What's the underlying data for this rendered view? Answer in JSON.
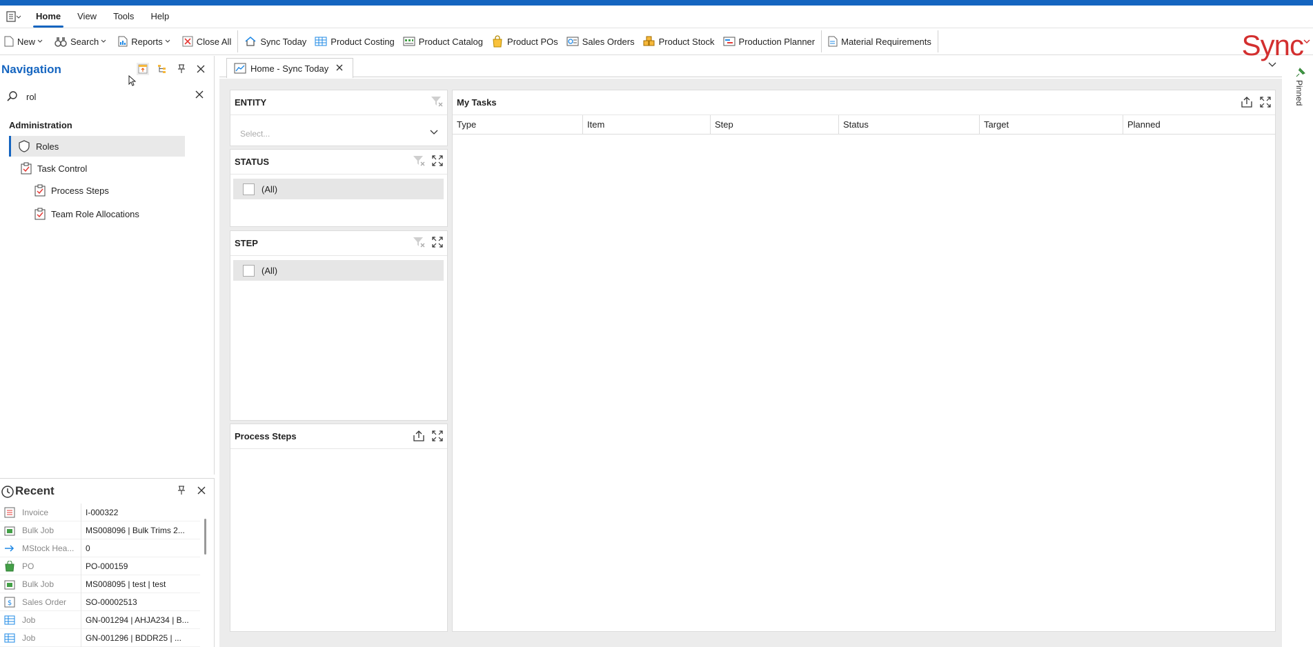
{
  "menubar": {
    "tabs": [
      "Home",
      "View",
      "Tools",
      "Help"
    ],
    "active_tab": "Home"
  },
  "toolbar": {
    "new_label": "New",
    "search_label": "Search",
    "reports_label": "Reports",
    "close_all_label": "Close All",
    "sync_today_label": "Sync Today",
    "product_costing_label": "Product Costing",
    "product_catalog_label": "Product Catalog",
    "product_pos_label": "Product POs",
    "sales_orders_label": "Sales Orders",
    "product_stock_label": "Product Stock",
    "production_planner_label": "Production Planner",
    "material_requirements_label": "Material Requirements",
    "brand": "Sync"
  },
  "navigation": {
    "title": "Navigation",
    "search_value": "rol",
    "group": "Administration",
    "items": [
      {
        "label": "Roles"
      },
      {
        "label": "Task Control"
      },
      {
        "label": "Process Steps"
      },
      {
        "label": "Team Role Allocations"
      }
    ]
  },
  "recent": {
    "title": "Recent",
    "rows": [
      {
        "type": "Invoice",
        "value": "I-000322"
      },
      {
        "type": "Bulk Job",
        "value": "MS008096 | Bulk Trims 2..."
      },
      {
        "type": "MStock Hea...",
        "value": "0"
      },
      {
        "type": "PO",
        "value": "PO-000159"
      },
      {
        "type": "Bulk Job",
        "value": "MS008095 | test | test"
      },
      {
        "type": "Sales Order",
        "value": "SO-00002513"
      },
      {
        "type": "Job",
        "value": "GN-001294 | AHJA234 | B..."
      },
      {
        "type": "Job",
        "value": "GN-001296 |  BDDR25 | ..."
      }
    ]
  },
  "document_tab": {
    "label": "Home - Sync Today"
  },
  "pinned_label": "Pinned",
  "entity_card": {
    "title": "ENTITY",
    "placeholder": "Select..."
  },
  "status_card": {
    "title": "STATUS",
    "all_label": "(All)"
  },
  "step_card": {
    "title": "STEP",
    "all_label": "(All)"
  },
  "process_steps_card": {
    "title": "Process Steps"
  },
  "tasks_card": {
    "title": "My Tasks",
    "columns": [
      "Type",
      "Item",
      "Step",
      "Status",
      "Target",
      "Planned"
    ]
  },
  "colors": {
    "accent": "#1565c0",
    "brand": "#d32f2f"
  }
}
